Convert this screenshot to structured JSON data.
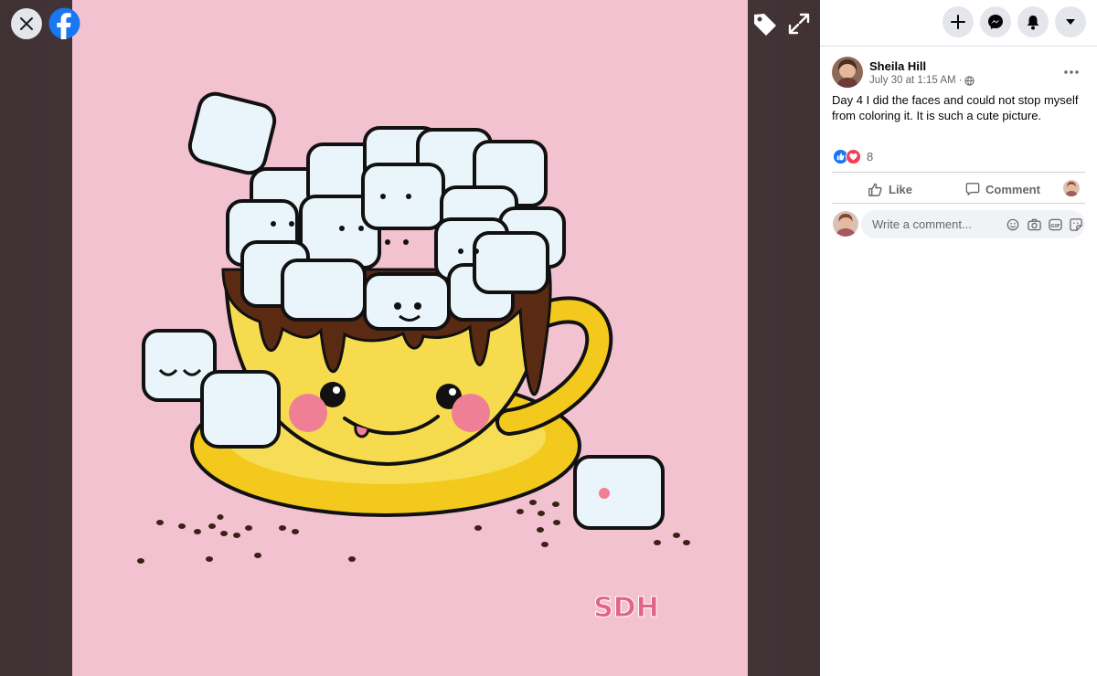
{
  "viewer": {
    "close_icon": "close-icon",
    "logo_icon": "facebook-logo-icon",
    "tag_icon": "tag-icon",
    "expand_icon": "expand-icon",
    "photo_watermark": "SDH"
  },
  "topbar": {
    "create_icon": "plus-icon",
    "messenger_icon": "messenger-icon",
    "notifications_icon": "bell-icon",
    "account_icon": "caret-down-icon"
  },
  "post": {
    "author": "Sheila Hill",
    "timestamp": "July 30 at 1:15 AM",
    "separator": "·",
    "privacy_icon": "globe-icon",
    "text": "Day 4 I did the faces and could not stop myself from coloring it. It is such a cute picture.",
    "reactions": {
      "icons": [
        "like-icon",
        "love-icon"
      ],
      "count": "8"
    },
    "actions": {
      "like": "Like",
      "comment": "Comment"
    },
    "comment_placeholder": "Write a comment...",
    "comment_tools": [
      "emoji-icon",
      "camera-icon",
      "gif-icon",
      "sticker-icon"
    ]
  },
  "colors": {
    "photo_background": "#f3c2d0",
    "facebook_blue": "#1877f2",
    "love_red": "#f33e58"
  }
}
